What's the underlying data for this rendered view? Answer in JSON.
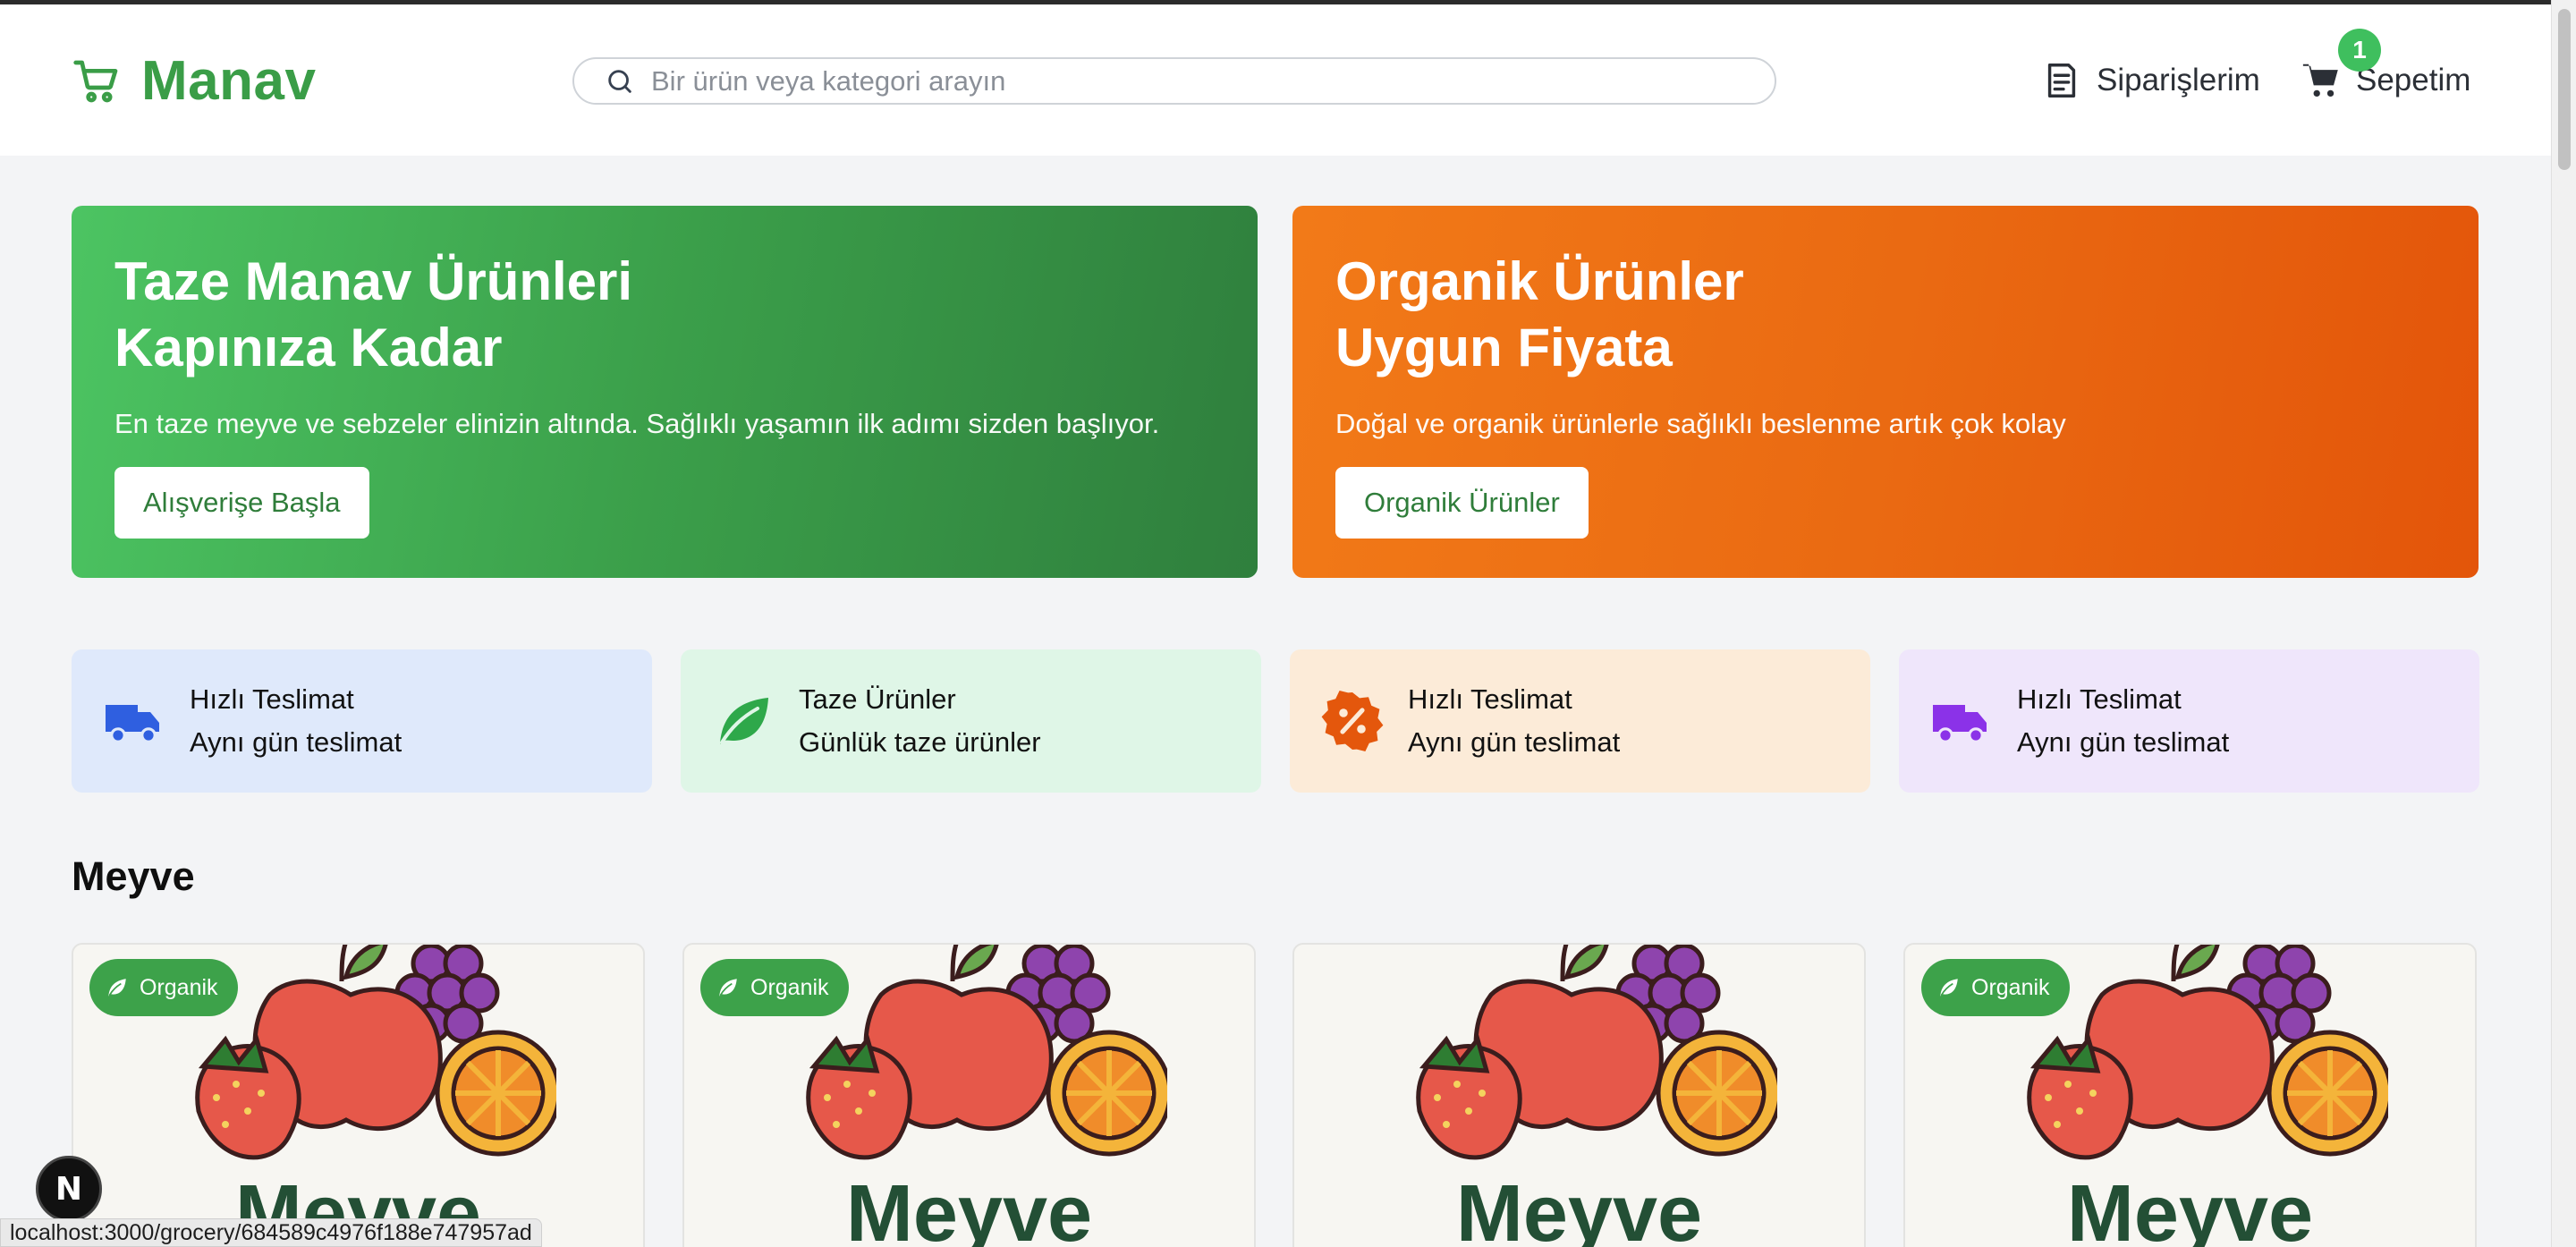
{
  "header": {
    "brand": "Manav",
    "search_placeholder": "Bir ürün veya kategori arayın",
    "orders_label": "Siparişlerim",
    "cart_label": "Sepetim",
    "cart_count": "1"
  },
  "hero": [
    {
      "title_line1": "Taze Manav Ürünleri",
      "title_line2": "Kapınıza Kadar",
      "text": "En taze meyve ve sebzeler elinizin altında. Sağlıklı yaşamın ilk adımı sizden başlıyor.",
      "button": "Alışverişe Başla"
    },
    {
      "title_line1": "Organik Ürünler",
      "title_line2": "Uygun Fiyata",
      "text": "Doğal ve organik ürünlerle sağlıklı beslenme artık çok kolay",
      "button": "Organik Ürünler"
    }
  ],
  "features": [
    {
      "title": "Hızlı Teslimat",
      "subtitle": "Aynı gün teslimat",
      "icon": "truck-icon",
      "color": "#2f5fe0"
    },
    {
      "title": "Taze Ürünler",
      "subtitle": "Günlük taze ürünler",
      "icon": "leaf-icon",
      "color": "#2ea84a"
    },
    {
      "title": "Hızlı Teslimat",
      "subtitle": "Aynı gün teslimat",
      "icon": "discount-badge-icon",
      "color": "#e4570c"
    },
    {
      "title": "Hızlı Teslimat",
      "subtitle": "Aynı gün teslimat",
      "icon": "truck-icon",
      "color": "#8b32e8"
    }
  ],
  "section": {
    "title": "Meyve"
  },
  "products": [
    {
      "category": "Meyve",
      "badge": "Organik"
    },
    {
      "category": "Meyve",
      "badge": "Organik"
    },
    {
      "category": "Meyve",
      "badge": ""
    },
    {
      "category": "Meyve",
      "badge": "Organik"
    }
  ],
  "dev_tools": {
    "label": "N"
  },
  "status_bar": {
    "url": "localhost:3000/grocery/684589c4976f188e747957ad"
  },
  "colors": {
    "brand_green": "#3a9d47",
    "hero_orange": "#ea6a12",
    "badge_green": "#3fbf5e"
  }
}
